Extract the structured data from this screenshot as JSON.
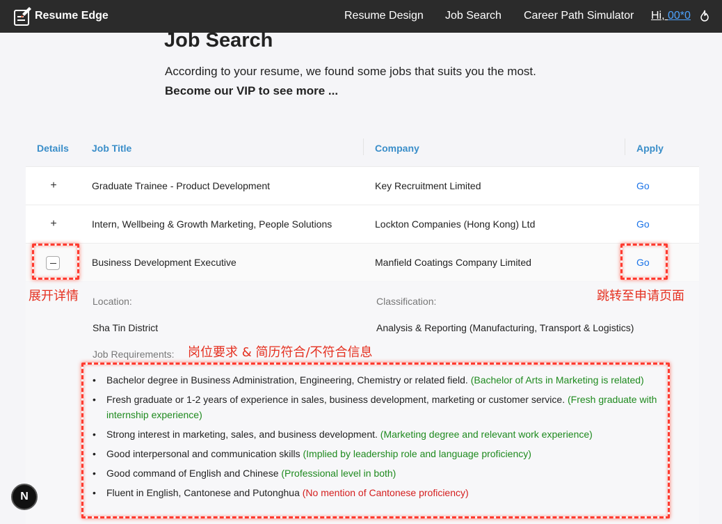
{
  "nav": {
    "brand": "Resume Edge",
    "links": [
      "Resume Design",
      "Job Search",
      "Career Path Simulator"
    ],
    "greeting": "Hi, ",
    "username": "00*0"
  },
  "header": {
    "title": "Job Search",
    "intro": "According to your resume, we found some jobs that suits you the most.",
    "vip": "Become our VIP to see more ..."
  },
  "table": {
    "columns": [
      "Details",
      "Job Title",
      "Company",
      "Apply"
    ],
    "rows": [
      {
        "title": "Graduate Trainee - Product Development",
        "company": "Key Recruitment Limited",
        "apply": "Go",
        "expander": "+"
      },
      {
        "title": "Intern, Wellbeing & Growth Marketing, People Solutions",
        "company": "Lockton Companies (Hong Kong) Ltd",
        "apply": "Go",
        "expander": "+"
      },
      {
        "title": "Business Development Executive",
        "company": "Manfield Coatings Company Limited",
        "apply": "Go",
        "expander": "−"
      }
    ]
  },
  "details": {
    "location_label": "Location:",
    "location_value": "Sha Tin District",
    "classification_label": "Classification:",
    "classification_value": "Analysis & Reporting (Manufacturing, Transport & Logistics)",
    "requirements_label": "Job Requirements:",
    "requirements": [
      {
        "text": "Bachelor degree in Business Administration, Engineering, Chemistry or related field. ",
        "note": "(Bachelor of Arts in Marketing is related)",
        "match": true
      },
      {
        "text": "Fresh graduate or 1-2 years of experience in sales, business development, marketing or customer service. ",
        "note": "(Fresh graduate with internship experience)",
        "match": true
      },
      {
        "text": "Strong interest in marketing, sales, and business development. ",
        "note": "(Marketing degree and relevant work experience)",
        "match": true
      },
      {
        "text": "Good interpersonal and communication skills ",
        "note": "(Implied by leadership role and language proficiency)",
        "match": true
      },
      {
        "text": "Good command of English and Chinese ",
        "note": "(Professional level in both)",
        "match": true
      },
      {
        "text": "Fluent in English, Cantonese and Putonghua ",
        "note": "(No mention of Cantonese proficiency)",
        "match": false
      }
    ],
    "bullet": "•"
  },
  "annotations": {
    "expand": "展开详情",
    "apply": "跳转至申请页面",
    "requirements": "岗位要求 & 简历符合/不符合信息"
  },
  "bubble": "N",
  "colors": {
    "navbar": "#2b2b2b",
    "header_text": "#3a8ec9",
    "link": "#1a73e8",
    "match": "#1e8a1e",
    "nomatch": "#d41d1d",
    "annotation": "#ff3b30"
  }
}
